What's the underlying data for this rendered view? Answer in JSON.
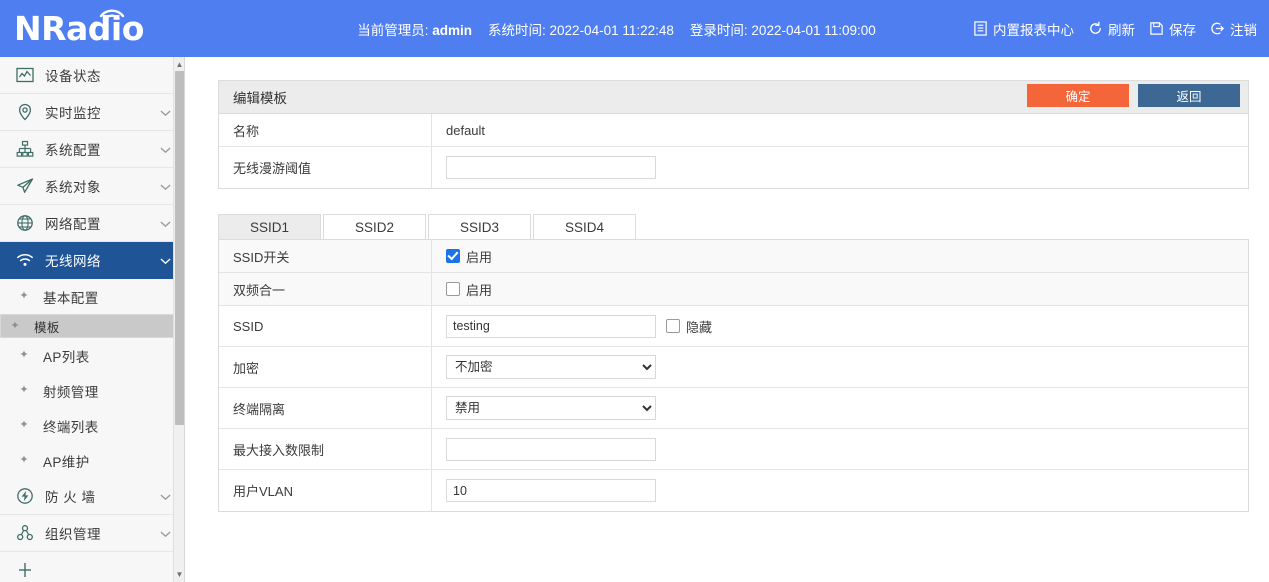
{
  "header": {
    "logo_text": "NRadio",
    "admin_label": "当前管理员:",
    "admin_value": "admin",
    "systime_label": "系统时间:",
    "systime_value": "2022-04-01 11:22:48",
    "logintime_label": "登录时间:",
    "logintime_value": "2022-04-01 11:09:00",
    "report_center": "内置报表中心",
    "refresh": "刷新",
    "save": "保存",
    "logout": "注销"
  },
  "sidebar": {
    "items": [
      {
        "label": "设备状态",
        "icon": "device-status-icon",
        "caret": false,
        "active": false
      },
      {
        "label": "实时监控",
        "icon": "location-pin-icon",
        "caret": true,
        "active": false
      },
      {
        "label": "系统配置",
        "icon": "sitemap-icon",
        "caret": true,
        "active": false
      },
      {
        "label": "系统对象",
        "icon": "paper-plane-icon",
        "caret": true,
        "active": false
      },
      {
        "label": "网络配置",
        "icon": "globe-icon",
        "caret": true,
        "active": false
      },
      {
        "label": "无线网络",
        "icon": "wifi-icon",
        "caret": true,
        "active": true
      }
    ],
    "subitems": [
      {
        "label": "基本配置",
        "selected": false
      },
      {
        "label": "模板",
        "selected": true
      },
      {
        "label": "AP列表",
        "selected": false
      },
      {
        "label": "射频管理",
        "selected": false
      },
      {
        "label": "终端列表",
        "selected": false
      },
      {
        "label": "AP维护",
        "selected": false
      }
    ],
    "items_bottom": [
      {
        "label": "防 火 墙",
        "icon": "firewall-icon",
        "caret": true,
        "active": false
      },
      {
        "label": "组织管理",
        "icon": "org-icon",
        "caret": true,
        "active": false
      }
    ]
  },
  "panel": {
    "title": "编辑模板",
    "confirm_label": "确定",
    "back_label": "返回",
    "rows": [
      {
        "label": "名称",
        "value": "default",
        "type": "text"
      },
      {
        "label": "无线漫游阈值",
        "value": "",
        "type": "input"
      }
    ]
  },
  "tabs": [
    {
      "label": "SSID1",
      "active": true
    },
    {
      "label": "SSID2",
      "active": false
    },
    {
      "label": "SSID3",
      "active": false
    },
    {
      "label": "SSID4",
      "active": false
    }
  ],
  "ssid_form": {
    "ssid_switch": {
      "label": "SSID开关",
      "checkbox_label": "启用",
      "checked": true
    },
    "dual_band": {
      "label": "双频合一",
      "checkbox_label": "启用",
      "checked": false
    },
    "ssid": {
      "label": "SSID",
      "value": "testing",
      "hidden_label": "隐藏",
      "hidden_checked": false
    },
    "encryption": {
      "label": "加密",
      "value": "不加密",
      "options": [
        "不加密"
      ]
    },
    "isolation": {
      "label": "终端隔离",
      "value": "禁用",
      "options": [
        "禁用"
      ]
    },
    "max_clients": {
      "label": "最大接入数限制",
      "value": ""
    },
    "user_vlan": {
      "label": "用户VLAN",
      "value": "10"
    }
  },
  "colors": {
    "header_blue": "#4f7ef0",
    "sidebar_active": "#1f5596",
    "confirm_orange": "#f4653a",
    "back_blue": "#3c6893",
    "checkbox_blue": "#1a73e8"
  }
}
